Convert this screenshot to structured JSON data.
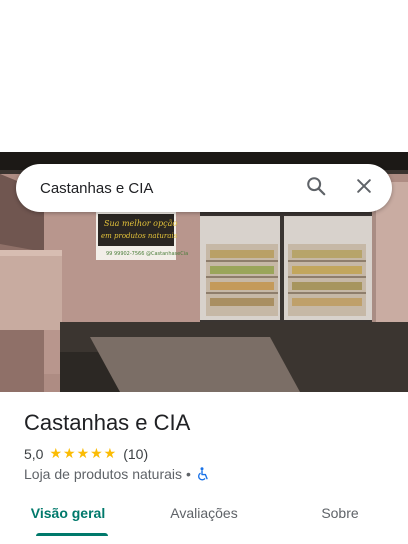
{
  "search": {
    "query": "Castanhas e CIA"
  },
  "place": {
    "name": "Castanhas e CIA",
    "rating": "5,0",
    "stars": "★★★★★",
    "review_count": "(10)",
    "category": "Loja de produtos naturais",
    "separator": "•"
  },
  "tabs": [
    {
      "label": "Visão geral",
      "active": true
    },
    {
      "label": "Avaliações",
      "active": false
    },
    {
      "label": "Sobre",
      "active": false
    }
  ],
  "colors": {
    "accent": "#00796b",
    "star": "#fbbc04",
    "accessibility": "#1a73e8"
  },
  "icons": {
    "search": "search-icon",
    "close": "close-icon",
    "accessibility": "wheelchair-icon"
  }
}
